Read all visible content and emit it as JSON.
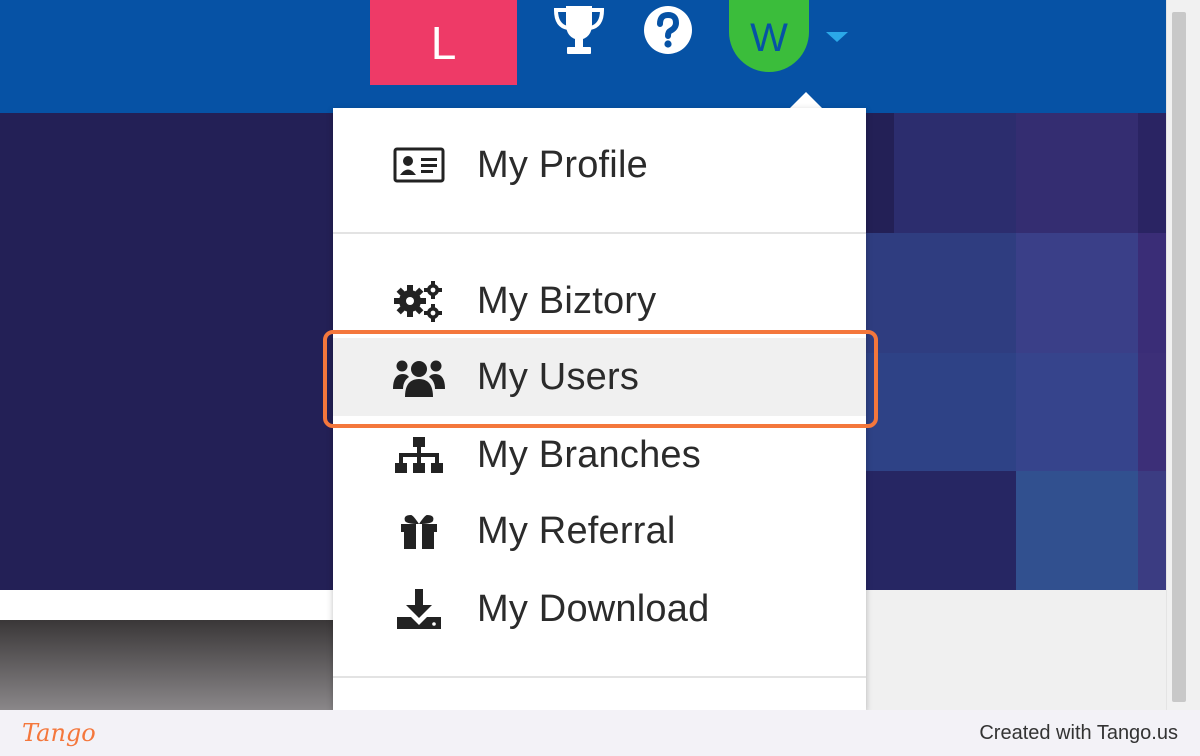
{
  "header": {
    "avatar_left_letter": "L",
    "avatar_right_letter": "W",
    "trophy_icon": "trophy-icon",
    "help_icon": "question-circle-icon",
    "dropdown_icon": "caret-down-icon"
  },
  "menu": {
    "items": [
      {
        "label": "My Profile",
        "icon": "id-card-icon"
      },
      {
        "label": "My Biztory",
        "icon": "gears-icon"
      },
      {
        "label": "My Users",
        "icon": "users-icon",
        "highlighted": true
      },
      {
        "label": "My Branches",
        "icon": "sitemap-icon"
      },
      {
        "label": "My Referral",
        "icon": "gift-icon"
      },
      {
        "label": "My Download",
        "icon": "download-icon"
      }
    ]
  },
  "footer": {
    "brand": "Tango",
    "credit": "Created with Tango.us"
  },
  "colors": {
    "header_blue": "#0652a5",
    "avatar_l_pink": "#ee3a67",
    "avatar_w_green": "#3bbd3b",
    "highlight_orange": "#f4773c",
    "hero_navy": "#232056"
  }
}
